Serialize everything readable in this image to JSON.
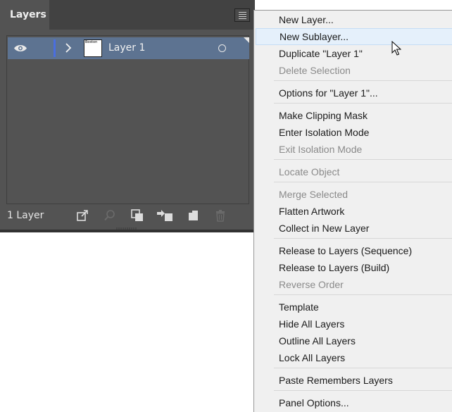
{
  "panel": {
    "tab_label": "Layers",
    "layer_count": "1 Layer",
    "layers": [
      {
        "name": "Layer 1",
        "thumb_text": "Boston",
        "color": "#4a6ee0"
      }
    ],
    "footer_icons": [
      "export-icon",
      "search-icon",
      "clipping-mask-icon",
      "move-selection-icon",
      "new-layer-icon",
      "trash-icon"
    ]
  },
  "menu": {
    "items": [
      {
        "label": "New Layer...",
        "enabled": true
      },
      {
        "label": "New Sublayer...",
        "enabled": true,
        "hover": true
      },
      {
        "label": "Duplicate \"Layer 1\"",
        "enabled": true
      },
      {
        "label": "Delete Selection",
        "enabled": false
      },
      {
        "label": "Options for \"Layer 1\"...",
        "enabled": true
      },
      {
        "label": "Make Clipping Mask",
        "enabled": true
      },
      {
        "label": "Enter Isolation Mode",
        "enabled": true
      },
      {
        "label": "Exit Isolation Mode",
        "enabled": false
      },
      {
        "label": "Locate Object",
        "enabled": false
      },
      {
        "label": "Merge Selected",
        "enabled": false
      },
      {
        "label": "Flatten Artwork",
        "enabled": true
      },
      {
        "label": "Collect in New Layer",
        "enabled": true
      },
      {
        "label": "Release to Layers (Sequence)",
        "enabled": true
      },
      {
        "label": "Release to Layers (Build)",
        "enabled": true
      },
      {
        "label": "Reverse Order",
        "enabled": false
      },
      {
        "label": "Template",
        "enabled": true
      },
      {
        "label": "Hide All Layers",
        "enabled": true
      },
      {
        "label": "Outline All Layers",
        "enabled": true
      },
      {
        "label": "Lock All Layers",
        "enabled": true
      },
      {
        "label": "Paste Remembers Layers",
        "enabled": true
      },
      {
        "label": "Panel Options...",
        "enabled": true
      }
    ]
  }
}
